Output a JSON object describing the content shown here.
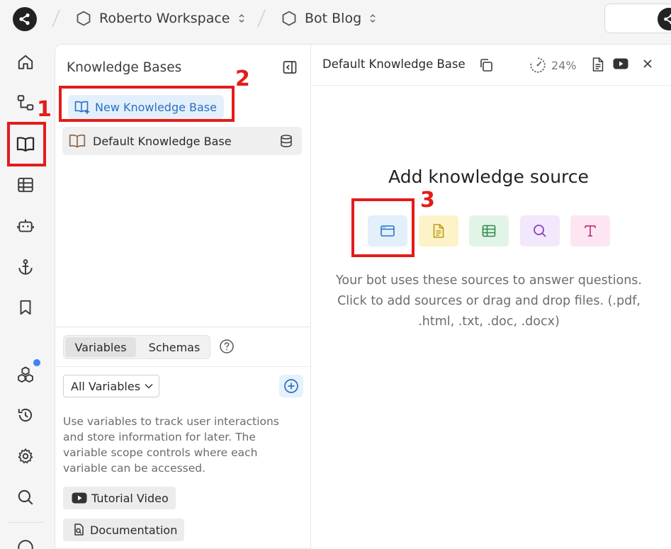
{
  "topbar": {
    "workspace": "Roberto Workspace",
    "project": "Bot Blog"
  },
  "panel": {
    "title": "Knowledge Bases",
    "new_kb_label": "New Knowledge Base",
    "kb_items": [
      "Default Knowledge Base"
    ],
    "tabs": [
      "Variables",
      "Schemas"
    ],
    "filter_value": "All Variables",
    "help_text": "Use variables to track user interactions and store information for later. The variable scope controls where each variable can be accessed.",
    "links": [
      "Tutorial Video",
      "Documentation"
    ]
  },
  "detail": {
    "title": "Default Knowledge Base",
    "usage": "24%",
    "heading": "Add knowledge source",
    "sources": [
      {
        "icon": "website-icon",
        "bg": "#e3f0fb",
        "color": "#2b73c9"
      },
      {
        "icon": "document-icon",
        "bg": "#fdf3c8",
        "color": "#c29a17"
      },
      {
        "icon": "table-icon",
        "bg": "#e2f4e8",
        "color": "#2d8a4e"
      },
      {
        "icon": "search-icon",
        "bg": "#f3e8fb",
        "color": "#8a3fbf"
      },
      {
        "icon": "text-icon",
        "bg": "#fde6f1",
        "color": "#c2367a"
      }
    ],
    "description": "Your bot uses these sources to answer questions. Click to add sources or drag and drop files. (.pdf, .html, .txt, .doc, .docx)"
  },
  "annotations": [
    "1",
    "2",
    "3"
  ],
  "colors": {
    "accent": "#2b6fc4",
    "annotation": "#e41b1b",
    "notification": "#3b82f6"
  }
}
